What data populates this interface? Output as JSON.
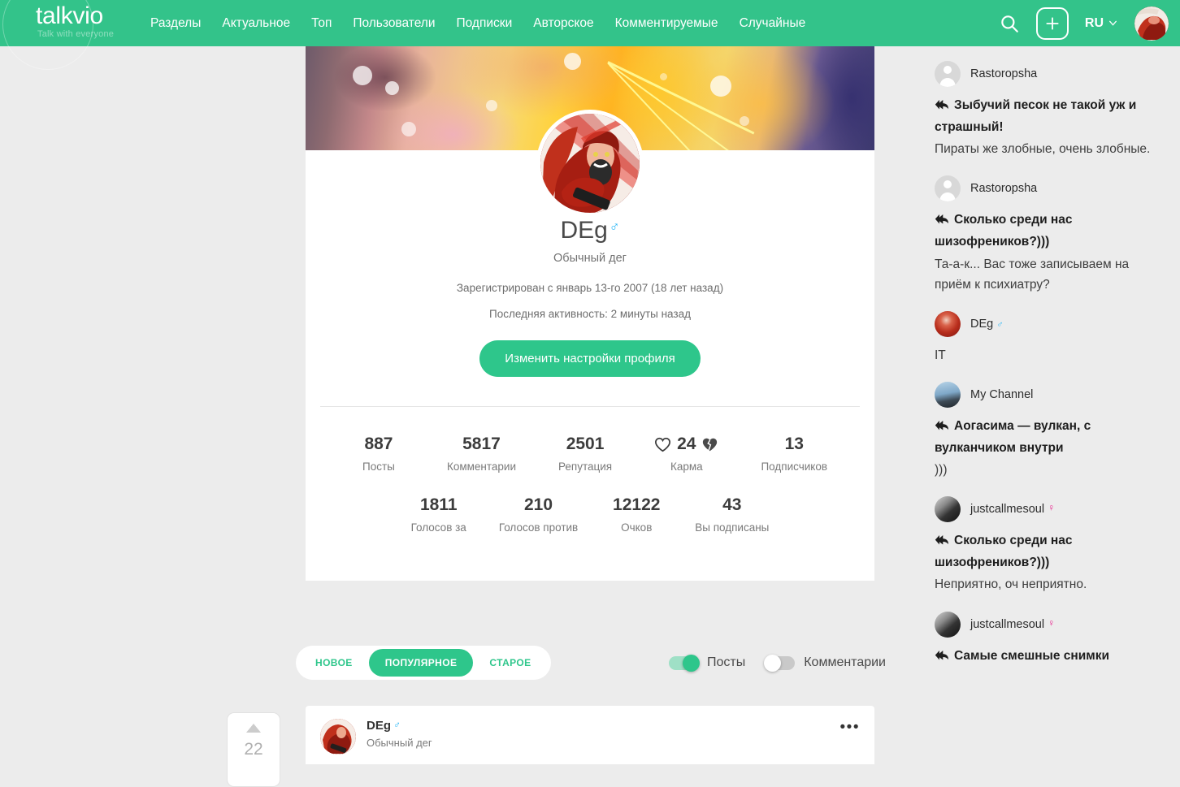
{
  "header": {
    "logo": "talkvio",
    "tagline": "Talk with everyone",
    "nav": [
      {
        "label": "Разделы"
      },
      {
        "label": "Актуальное"
      },
      {
        "label": "Топ"
      },
      {
        "label": "Пользователи"
      },
      {
        "label": "Подписки"
      },
      {
        "label": "Авторское"
      },
      {
        "label": "Комментируемые"
      },
      {
        "label": "Случайные"
      }
    ],
    "search_icon": "search-icon",
    "create_icon": "plus-icon",
    "lang": "RU",
    "lang_chevron": "chevron-down-icon",
    "avatar": "user-avatar"
  },
  "profile": {
    "username": "DEg",
    "gender_symbol": "♂",
    "status": "Обычный дег",
    "registered": "Зарегистрирован с январь 13-го 2007 (18 лет назад)",
    "last_activity": "Последняя активность: 2 минуты назад",
    "edit_button": "Изменить настройки профиля",
    "stats_row1": [
      {
        "value": "887",
        "label": "Посты"
      },
      {
        "value": "5817",
        "label": "Комментарии"
      },
      {
        "value": "2501",
        "label": "Репутация"
      },
      {
        "value": "24",
        "label": "Карма"
      },
      {
        "value": "13",
        "label": "Подписчиков"
      }
    ],
    "stats_row2": [
      {
        "value": "1811",
        "label": "Голосов за"
      },
      {
        "value": "210",
        "label": "Голосов против"
      },
      {
        "value": "12122",
        "label": "Очков"
      },
      {
        "value": "43",
        "label": "Вы подписаны"
      }
    ]
  },
  "filters": {
    "pills": [
      {
        "label": "НОВОЕ",
        "active": false
      },
      {
        "label": "ПОПУЛЯРНОЕ",
        "active": true
      },
      {
        "label": "СТАРОЕ",
        "active": false
      }
    ],
    "toggles": [
      {
        "label": "Посты",
        "on": true
      },
      {
        "label": "Комментарии",
        "on": false
      }
    ]
  },
  "post": {
    "votes": "22",
    "up_icon": "triangle-up-icon",
    "author": "DEg",
    "gender_symbol": "♂",
    "author_status": "Обычный дег",
    "menu_icon": "more-options-icon"
  },
  "sidebar": {
    "comments": [
      {
        "user": "Rastoropsha",
        "gender": "",
        "avatar": "placeholder-avatar",
        "title": "Зыбучий песок не такой уж и страшный!",
        "text": "Пираты же злобные, очень злобные."
      },
      {
        "user": "Rastoropsha",
        "gender": "",
        "avatar": "placeholder-avatar",
        "title": "Сколько среди нас шизофреников?)))",
        "text": "Та-а-к...  Вас тоже записываем на приём к психиатру?"
      },
      {
        "user": "DEg",
        "gender": "♂",
        "avatar": "deg-avatar",
        "title": "",
        "text": "IT"
      },
      {
        "user": "My Channel",
        "gender": "",
        "avatar": "channel-avatar",
        "title": "Аогасима — вулкан, с вулканчиком внутри",
        "text": ")))"
      },
      {
        "user": "justcallmesoul",
        "gender": "♀",
        "avatar": "soul-avatar",
        "title": "Сколько среди нас шизофреников?)))",
        "text": "Неприятно, оч неприятно."
      },
      {
        "user": "justcallmesoul",
        "gender": "♀",
        "avatar": "soul-avatar",
        "title": "Самые смешные снимки",
        "text": ""
      }
    ]
  },
  "colors": {
    "brand_green": "#33c38a",
    "button_green": "#2ec68b",
    "page_bg": "#ececec",
    "male_blue": "#29b6f6",
    "female_pink": "#e91e8c"
  }
}
